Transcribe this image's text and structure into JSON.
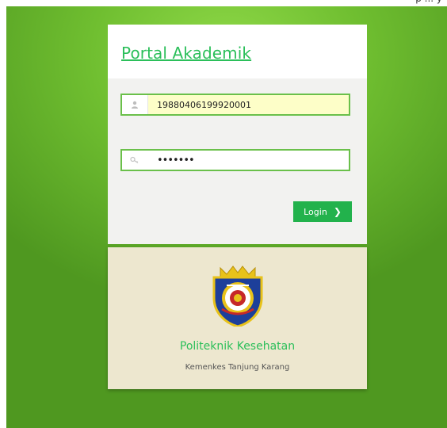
{
  "header": {
    "title": "Portal Akademik"
  },
  "form": {
    "username_value": "19880406199920001",
    "password_value": "•••••••",
    "login_label": "Login",
    "icons": {
      "user": "user-icon",
      "password": "key-icon",
      "login": "chevron-right-icon"
    }
  },
  "footer": {
    "institution_name": "Politeknik Kesehatan",
    "institution_sub": "Kemenkes Tanjung Karang",
    "logo": "institution-logo"
  },
  "colors": {
    "accent_green": "#22b24c",
    "title_green": "#2bbf5a",
    "background_green": "#6fbe30",
    "field_highlight": "#fdfec8",
    "footer_bg": "#ede7cf"
  }
}
